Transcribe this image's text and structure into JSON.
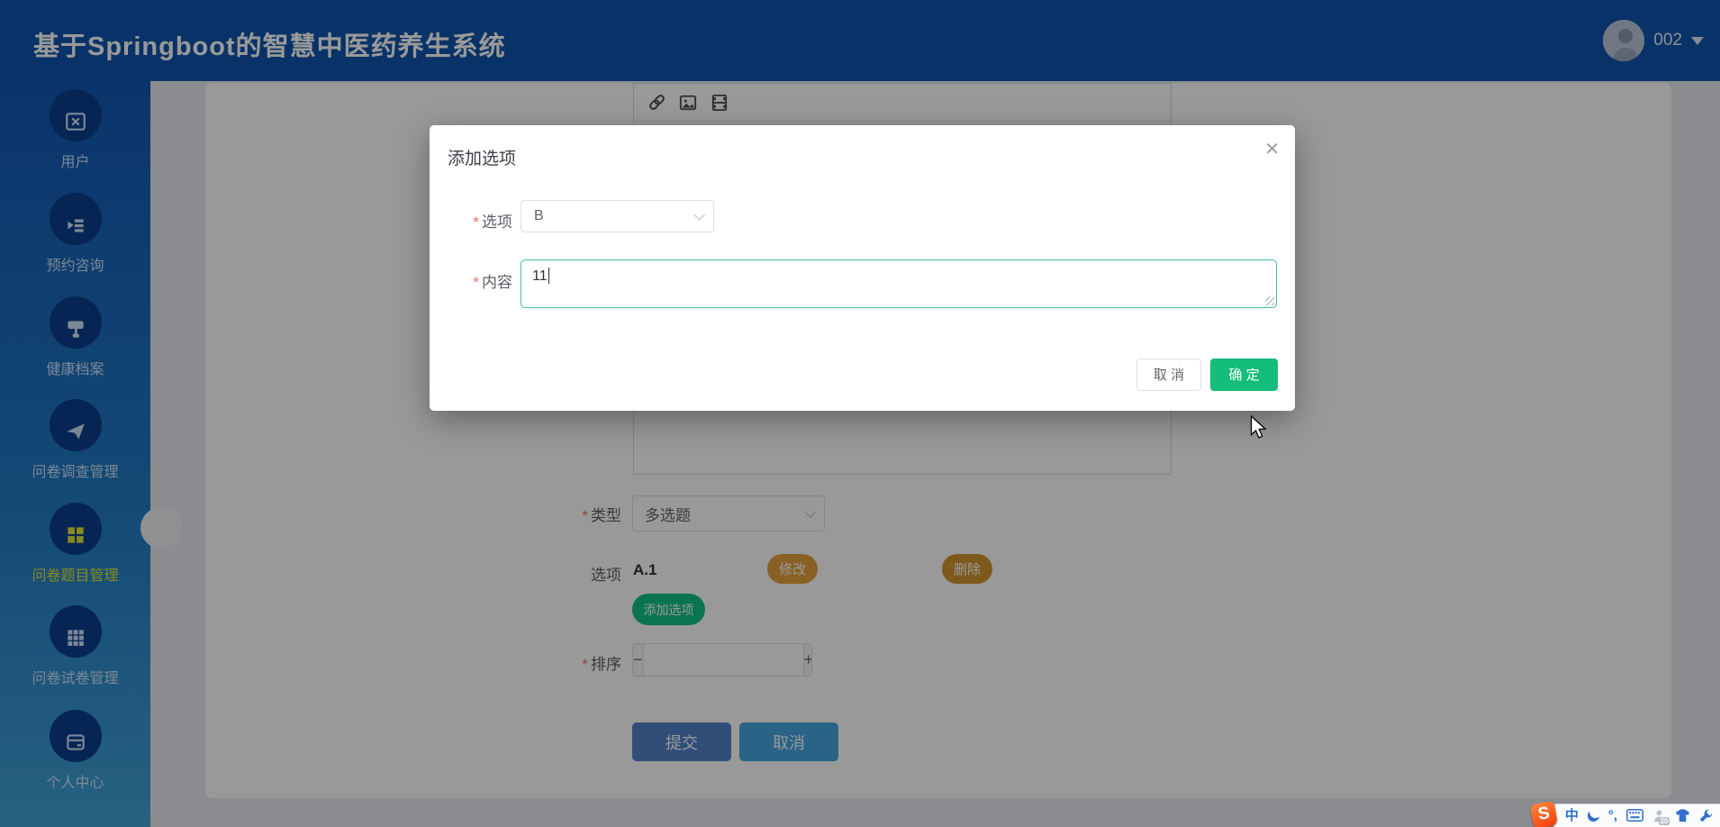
{
  "required_mark": "*",
  "header": {
    "title": "基于Springboot的智慧中医药养生系统",
    "username": "002"
  },
  "sidebar": {
    "items": [
      {
        "label": "用户"
      },
      {
        "label": "预约咨询"
      },
      {
        "label": "健康档案"
      },
      {
        "label": "问卷调查管理"
      },
      {
        "label": "问卷题目管理",
        "active": true
      },
      {
        "label": "问卷试卷管理"
      },
      {
        "label": "个人中心"
      }
    ]
  },
  "form": {
    "type_label": "类型",
    "type_value": "多选题",
    "option_label": "选项",
    "option_value": "A.1",
    "modify_label": "修改",
    "delete_label": "删除",
    "add_option_label": "添加选项",
    "sort_label": "排序",
    "minus_glyph": "−",
    "plus_glyph": "+",
    "submit_label": "提交",
    "cancel_label": "取消"
  },
  "modal": {
    "title": "添加选项",
    "close_glyph": "✕",
    "option_label": "选项",
    "option_value": "B",
    "content_label": "内容",
    "content_value": "11",
    "cancel_label": "取 消",
    "confirm_label": "确 定"
  },
  "ime": {
    "logo": "S",
    "mode": "中",
    "punct": "°,",
    "badge": "20"
  },
  "colors": {
    "header_blue": "#0f55ad",
    "sidebar_gradient_top": "#1158b4",
    "sidebar_gradient_bottom": "#41a3d6",
    "active_item_yellow": "#e3e635",
    "confirm_green": "#15bd7b",
    "add_option_green": "#12c287",
    "warning_gold": "#e6a23c",
    "submit_blue": "#5382c8",
    "cancel_blue": "#45a5e0",
    "textarea_focus_teal": "#3fbfa0",
    "required_red": "#f56c6c"
  }
}
